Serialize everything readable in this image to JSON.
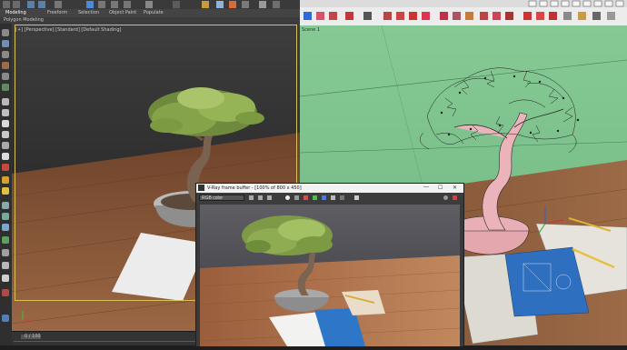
{
  "max": {
    "tabs": [
      "Modeling",
      "Freeform",
      "Selection",
      "Object Paint",
      "Populate"
    ],
    "submenu": "Polygon Modeling",
    "viewport_label": "[+] [Perspective] [Standard] [Default Shading]",
    "timeline_frame": "0 / 100"
  },
  "sketchup": {
    "scene_tab": "Scene 1"
  },
  "vfb": {
    "title": "V-Ray frame buffer - [100% of 800 x 450]",
    "channel": "RGB color",
    "window_buttons": [
      "—",
      "☐",
      "✕"
    ]
  },
  "colors": {
    "max_bg": "#2a2a2a",
    "viewport_wall": "#3b3b3b",
    "table_wood": "#8b5a3c",
    "sketchup_sky": "#7ec38e",
    "sketchup_toolbar": "#ececec",
    "vray_frame": "#3a3a3a",
    "selection_border": "#d9c15a"
  }
}
